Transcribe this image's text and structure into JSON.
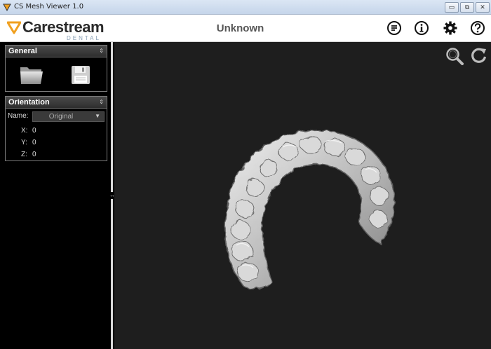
{
  "window": {
    "title": "CS Mesh Viewer 1.0",
    "min_glyph": "▭",
    "max_glyph": "⧉",
    "close_glyph": "✕"
  },
  "header": {
    "logo_main": "Carestream",
    "logo_sub": "DENTAL",
    "title": "Unknown",
    "icons": [
      "notes-icon",
      "info-icon",
      "gear-icon",
      "help-icon"
    ]
  },
  "sidebar": {
    "general": {
      "title": "General",
      "collapse_glyph": "⇕",
      "icons": [
        "folder-icon",
        "save-icon"
      ]
    },
    "orientation": {
      "title": "Orientation",
      "collapse_glyph": "⇕",
      "name_label": "Name:",
      "name_value": "Original",
      "select_arrow": "▼",
      "x_label": "X:",
      "x_value": "0",
      "y_label": "Y:",
      "y_value": "0",
      "z_label": "Z:",
      "z_value": "0"
    },
    "splitter_glyph": "↔"
  },
  "viewport": {
    "icons": [
      "zoom-icon",
      "reset-view-icon"
    ],
    "model": "dental-arch-mesh"
  },
  "colors": {
    "accent_orange": "#f0a020",
    "header_bg": "#ffffff",
    "viewport_bg": "#1e1e1e",
    "sidebar_bg": "#000000",
    "mesh_light": "#d8d8d8",
    "mesh_shadow": "#6a6a6a"
  }
}
